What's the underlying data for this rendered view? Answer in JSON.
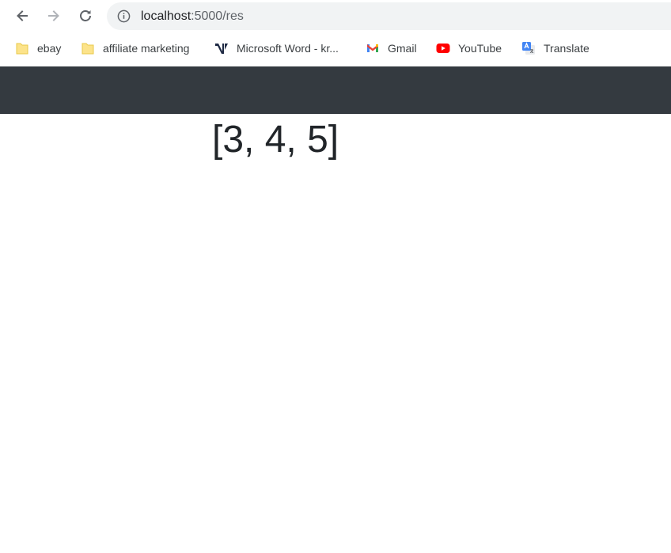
{
  "browser": {
    "url_host": "localhost",
    "url_path": ":5000/res"
  },
  "bookmarks": [
    {
      "label": "ebay",
      "icon": "folder-icon"
    },
    {
      "label": "affiliate marketing",
      "icon": "folder-icon"
    },
    {
      "label": "Microsoft Word - kr...",
      "icon": "site-logo-icon"
    },
    {
      "label": "Gmail",
      "icon": "gmail-icon"
    },
    {
      "label": "YouTube",
      "icon": "youtube-icon"
    },
    {
      "label": "Translate",
      "icon": "translate-icon"
    }
  ],
  "page": {
    "result_text": "[3, 4, 5]",
    "navbar_color": "#343a40"
  }
}
